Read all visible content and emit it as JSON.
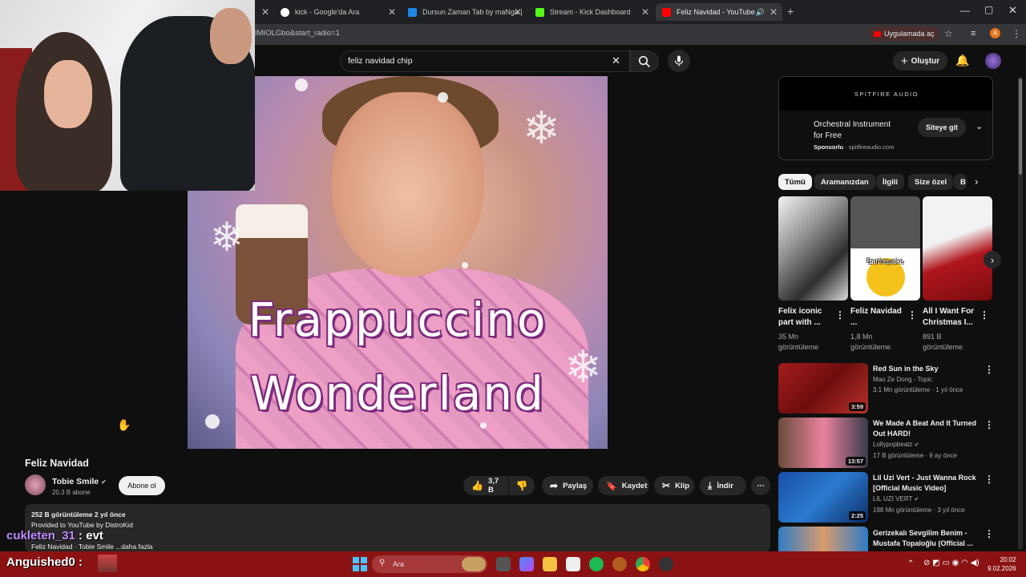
{
  "browser": {
    "tabs": [
      {
        "label": "kick - Google'da Ara",
        "color": "#4285f4"
      },
      {
        "label": "Dursun Zaman Tab by maNga |",
        "color": "#1e88e5"
      },
      {
        "label": "Stream - Kick Dashboard",
        "color": "#53fc18"
      },
      {
        "label": "Feliz Navidad - YouTube",
        "color": "#ff0000"
      }
    ],
    "new_tab": "+",
    "url": "IMIOLGbo&start_radio=1",
    "open_in_app": "Uygulamada aç",
    "profile_initial": "A"
  },
  "search": {
    "query": "feliz navidad chip",
    "clear": "✕"
  },
  "header": {
    "create": "Oluştur"
  },
  "video": {
    "overlay_line1": "Frappuccino",
    "overlay_line2": "Wonderland",
    "title": "Feliz Navidad",
    "channel": "Tobie Smile",
    "subscribers": "20,3 B abone",
    "subscribe": "Abone ol",
    "likes": "3,7 B",
    "share": "Paylaş",
    "save": "Kaydet",
    "clip": "Klip",
    "download": "İndir",
    "desc_line1": "252 B görüntüleme  2 yıl önce",
    "desc_line2": "Provided to YouTube by DistroKid",
    "desc_line3": "Feliz Navidad · Tobie Smile  ...daha fazla"
  },
  "ad": {
    "brand": "SPITFIRE AUDIO",
    "title": "Orchestral Instrument for Free",
    "sponsored": "Sponsorlu",
    "domain": "· spitfireaudio.com",
    "cta": "Siteye git"
  },
  "chips": [
    "Tümü",
    "Aramanızdan",
    "İlgili",
    "Size özel",
    "B"
  ],
  "shorts": [
    {
      "title": "Felix iconic part with ...",
      "views": "35 Mn görüntüleme"
    },
    {
      "title": "Feliz Navidad ...",
      "views": "1,8 Mn görüntüleme",
      "overlay": "Earthquake"
    },
    {
      "title": "All I Want For Christmas I...",
      "views": "891 B görüntüleme"
    }
  ],
  "recommendations": [
    {
      "title": "Red Sun in the Sky",
      "channel": "Mao Ze Dong - Topic",
      "meta": "3,1 Mn görüntüleme · 1 yıl önce",
      "duration": "3:59"
    },
    {
      "title": "We Made A Beat And It Turned Out HARD!",
      "channel": "Lollypopbeatz",
      "meta": "17 B görüntüleme · 9 ay önce",
      "duration": "13:57"
    },
    {
      "title": "Lil Uzi Vert - Just Wanna Rock [Official Music Video]",
      "channel": "LIL UZI VERT",
      "meta": "198 Mn görüntüleme · 3 yıl önce",
      "duration": "2:25"
    },
    {
      "title": "Gerizekalı Sevgilim Benim - Mustafa Topaloğlu (Official ...",
      "channel": "",
      "meta": "",
      "duration": ""
    }
  ],
  "chat": {
    "user1": "cukleten_31",
    "msg1": " : evt",
    "user2": "Anguished0 :"
  },
  "taskbar": {
    "search": "Ara",
    "time": "20:02",
    "date": "9.02.2026"
  }
}
